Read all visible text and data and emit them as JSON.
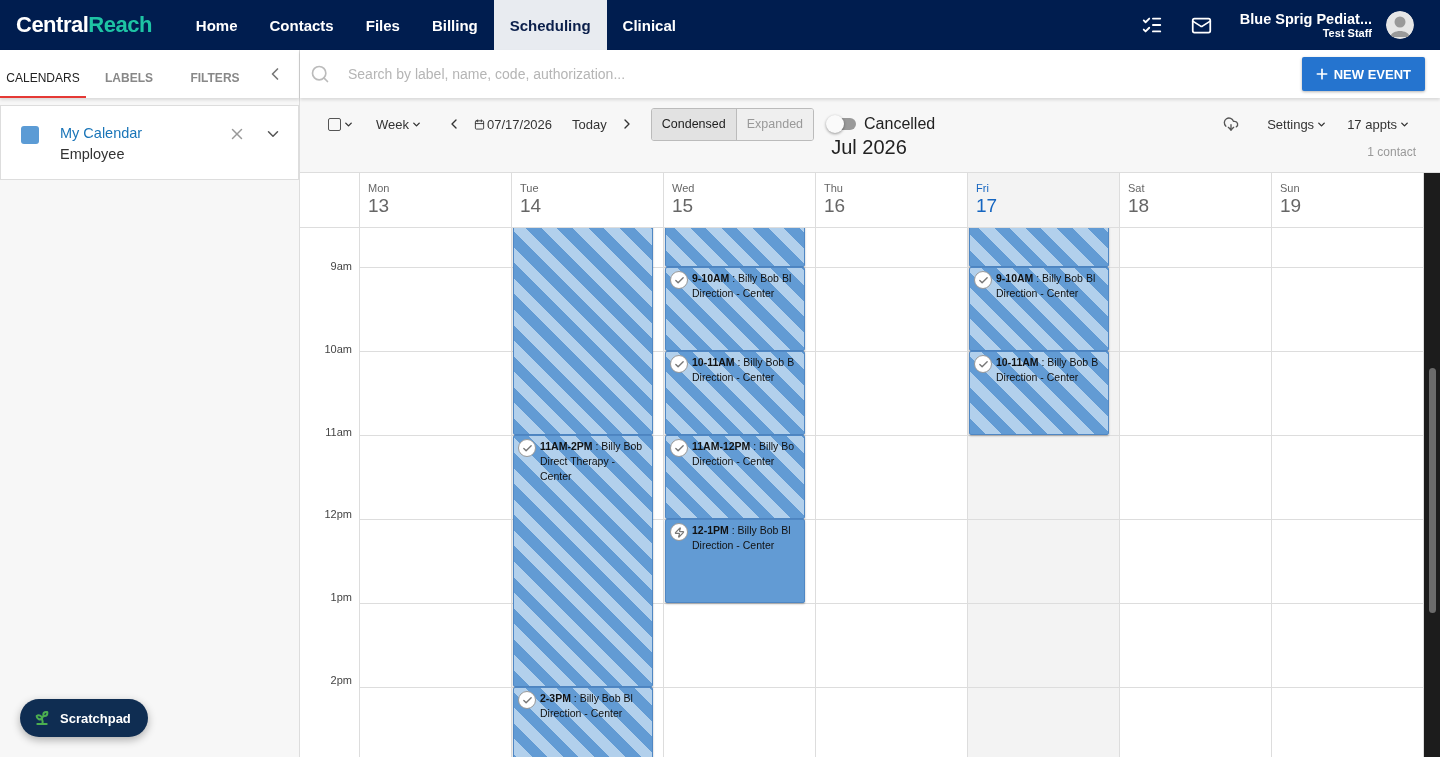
{
  "nav": {
    "logo": {
      "part_1": "Central",
      "part_2": "Reach"
    },
    "items": [
      {
        "label": "Home",
        "selected": false
      },
      {
        "label": "Contacts",
        "selected": false
      },
      {
        "label": "Files",
        "selected": false
      },
      {
        "label": "Billing",
        "selected": false
      },
      {
        "label": "Scheduling",
        "selected": true
      },
      {
        "label": "Clinical",
        "selected": false
      }
    ],
    "account": {
      "name": "Blue Sprig Pediat...",
      "role": "Test Staff"
    }
  },
  "sidebar": {
    "tabs": [
      {
        "label": "CALENDARS",
        "selected": true
      },
      {
        "label": "LABELS",
        "selected": false
      },
      {
        "label": "FILTERS",
        "selected": false
      }
    ],
    "calendars": [
      {
        "name": "My Calendar",
        "type": "Employee",
        "color": "#5b9bd5"
      }
    ],
    "scratchpad": "Scratchpad"
  },
  "search": {
    "placeholder": "Search by label, name, code, authorization..."
  },
  "new_event_button": "NEW EVENT",
  "toolbar": {
    "view": "Week",
    "date": "07/17/2026",
    "today": "Today",
    "modes": [
      {
        "label": "Condensed",
        "selected": true
      },
      {
        "label": "Expanded",
        "selected": false
      }
    ],
    "cancelled": {
      "label": "Cancelled",
      "on": false
    },
    "settings": "Settings",
    "appointments": "17 appts",
    "month": "Jul 2026",
    "contacts": "1 contact"
  },
  "calendar": {
    "hours": [
      "9am",
      "10am",
      "11am",
      "12pm",
      "1pm",
      "2pm"
    ],
    "days": [
      {
        "name": "Mon",
        "date": "13",
        "today": false
      },
      {
        "name": "Tue",
        "date": "14",
        "today": false,
        "events": [
          {
            "kind": "confirmed"
          },
          {
            "kind": "confirmed",
            "title": "**11AM-2PM** : Billy Bob",
            "detail": "Direct Therapy - Center"
          },
          {
            "kind": "confirmed",
            "title": "**2-3PM** : Billy Bob Bl",
            "detail": "Direction - Center"
          }
        ]
      },
      {
        "name": "Wed",
        "date": "15",
        "today": false,
        "events": [
          {
            "kind": "confirmed"
          },
          {
            "kind": "confirmed",
            "title": "**9-10AM** : Billy Bob Bl",
            "detail": "Direction - Center"
          },
          {
            "kind": "confirmed",
            "title": "**10-11AM** : Billy Bob B",
            "detail": "Direction - Center"
          },
          {
            "kind": "confirmed",
            "title": "**11AM-12PM** : Billy Bo",
            "detail": "Direction - Center"
          },
          {
            "kind": "pending",
            "title": "**12-1PM** : Billy Bob Bl",
            "detail": "Direction - Center"
          }
        ]
      },
      {
        "name": "Thu",
        "date": "16",
        "today": false
      },
      {
        "name": "Fri",
        "date": "17",
        "today": true,
        "events": [
          {
            "kind": "confirmed"
          },
          {
            "kind": "confirmed",
            "title": "**9-10AM** : Billy Bob Bl",
            "detail": "Direction - Center"
          },
          {
            "kind": "confirmed",
            "title": "**10-11AM** : Billy Bob B",
            "detail": "Direction - Center"
          }
        ]
      },
      {
        "name": "Sat",
        "date": "18",
        "today": false
      },
      {
        "name": "Sun",
        "date": "19",
        "today": false
      }
    ]
  }
}
